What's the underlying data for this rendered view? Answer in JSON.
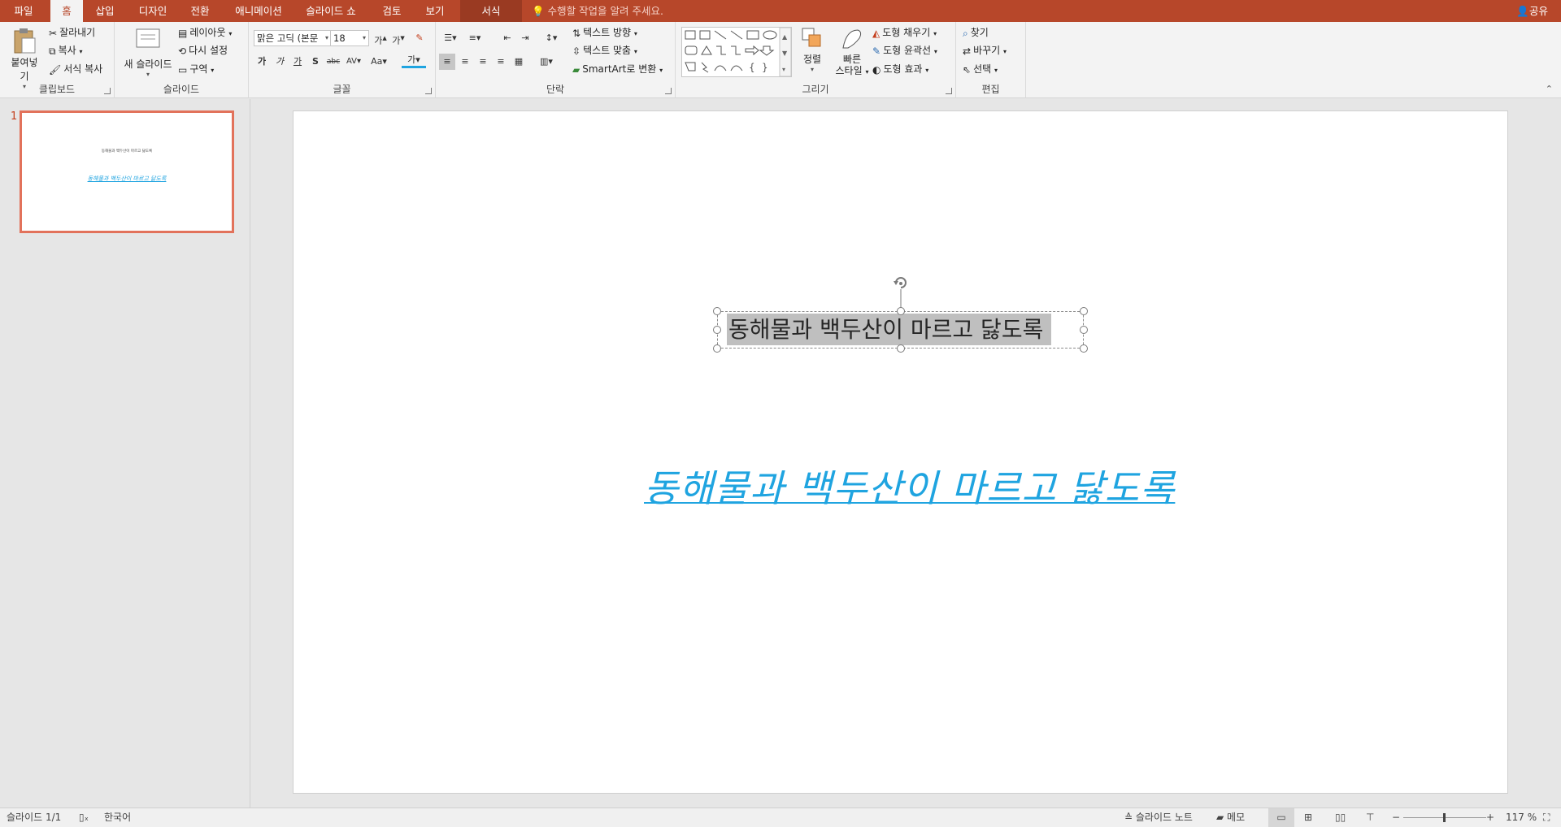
{
  "tabs": [
    "파일",
    "홈",
    "삽입",
    "디자인",
    "전환",
    "애니메이션",
    "슬라이드 쇼",
    "검토",
    "보기",
    "서식"
  ],
  "active_tab": "홈",
  "tell_me": "수행할 작업을 알려 주세요.",
  "share": "공유",
  "ribbon": {
    "clipboard": {
      "label": "클립보드",
      "paste": "붙여넣기",
      "cut": "잘라내기",
      "copy": "복사",
      "format_painter": "서식 복사"
    },
    "slides": {
      "label": "슬라이드",
      "new_slide": "새 슬라이드",
      "layout": "레이아웃",
      "reset": "다시 설정",
      "section": "구역"
    },
    "font": {
      "label": "글꼴",
      "font_name": "맑은 고딕 (본문",
      "font_size": "18"
    },
    "paragraph": {
      "label": "단락",
      "text_direction": "텍스트 방향",
      "align_text": "텍스트 맞춤",
      "smartart": "SmartArt로 변환"
    },
    "drawing": {
      "label": "그리기",
      "arrange": "정렬",
      "quick_styles_1": "빠른",
      "quick_styles_2": "스타일",
      "shape_fill": "도형 채우기",
      "shape_outline": "도형 윤곽선",
      "shape_effects": "도형 효과"
    },
    "editing": {
      "label": "편집",
      "find": "찾기",
      "replace": "바꾸기",
      "select": "선택"
    }
  },
  "thumbnail": {
    "number": "1",
    "line1": "동해물과 백두산이 마르고 닳도록",
    "line2": "동해물과 백두산이 마르고 닳도록"
  },
  "slide": {
    "text_selected": "동해물과 백두산이 마르고 닳도록",
    "text_link": "동해물과 백두산이 마르고 닳도록"
  },
  "status": {
    "slide_count": "슬라이드 1/1",
    "language": "한국어",
    "notes": "슬라이드 노트",
    "comments": "메모",
    "zoom": "117 %"
  },
  "colors": {
    "accent": "#b7472a",
    "link": "#1fa4e0",
    "thumb_border": "#e2725b"
  }
}
